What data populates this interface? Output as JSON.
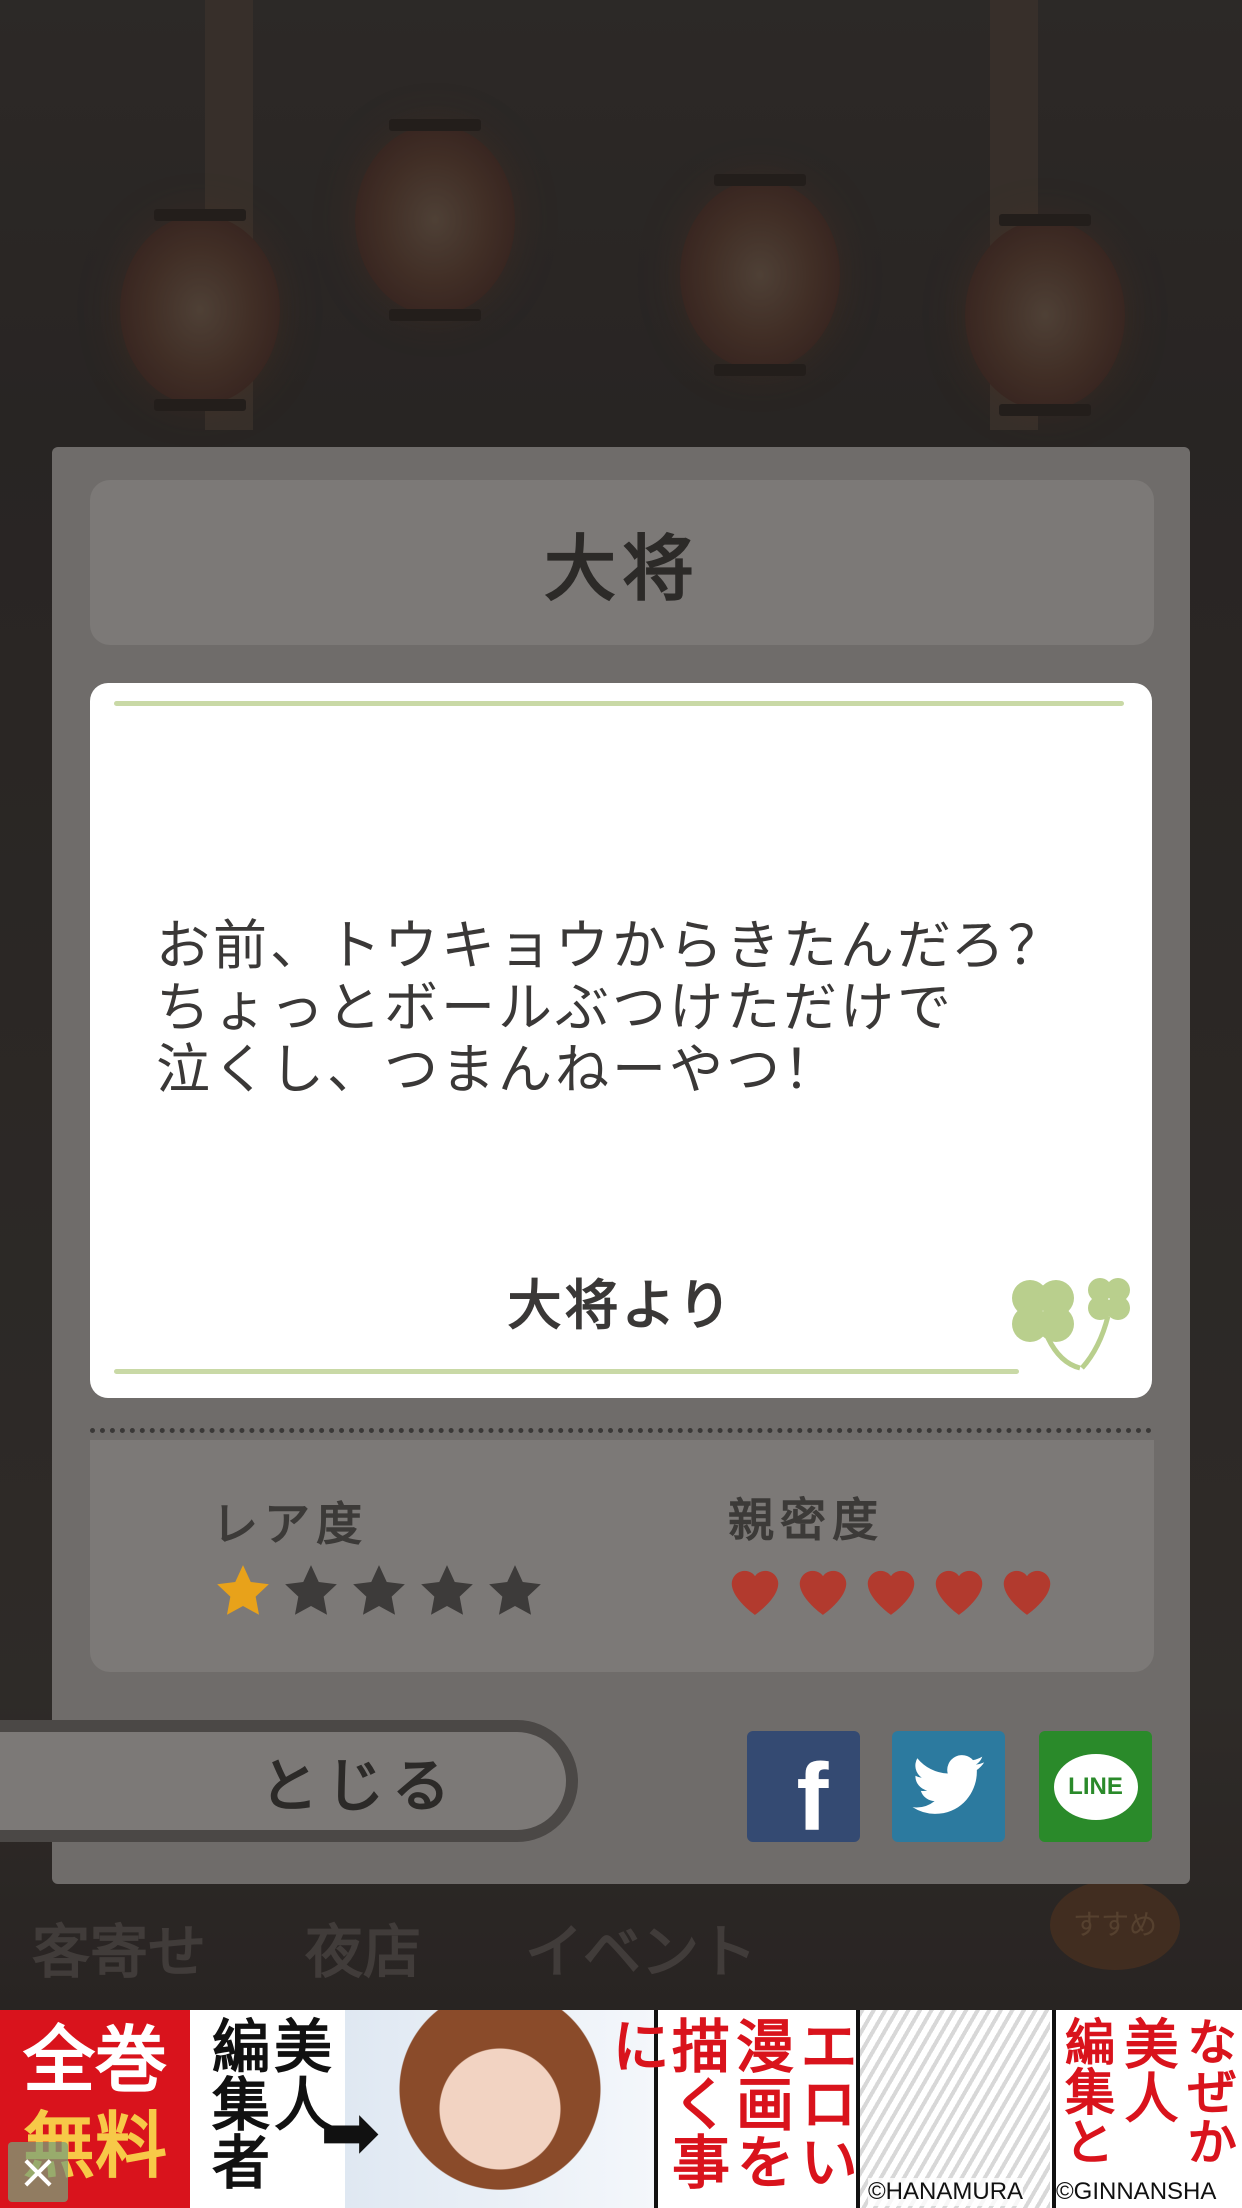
{
  "background": {
    "menu_labels": [
      "客寄せ",
      "夜店",
      "イベント"
    ],
    "badge_text": "すすめ"
  },
  "modal": {
    "title": "大将",
    "letter": {
      "body": "お前、トウキョウからきたんだろ？\nちょっとボールぶつけただけで\n泣くし、つまんねーやつ！",
      "signature": "大将より"
    },
    "rarity": {
      "label": "レア度",
      "value": 1,
      "max": 5,
      "color": "#e8a21a"
    },
    "intimacy": {
      "label": "親密度",
      "value": 5,
      "max": 5,
      "color": "#b23a2e"
    },
    "close_label": "とじる",
    "share": {
      "facebook": "f",
      "line": "LINE"
    }
  },
  "ad": {
    "badge_top": "全巻",
    "badge_bottom": "無料",
    "close": "×",
    "col1": "編集者",
    "col2": "美人",
    "col3": "描く事に",
    "col4": "漫画を",
    "col5": "エロい",
    "col6": "編集と",
    "col7": "美人",
    "col8": "なぜか",
    "credit_left": "©HANAMURA",
    "credit_right": "©GINNANSHA"
  }
}
